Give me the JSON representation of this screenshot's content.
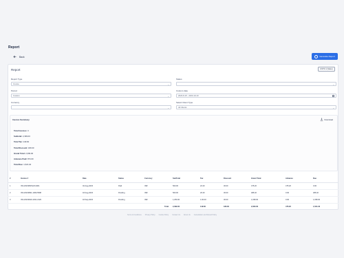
{
  "page": {
    "title": "Report"
  },
  "header": {
    "back_label": "Back",
    "generate_label": "Generate Report"
  },
  "card": {
    "title": "Report",
    "gstr_button": "GSTR-1 (Sales)",
    "fields": {
      "report_type": {
        "label": "Report Type",
        "value": "Invoice"
      },
      "status": {
        "label": "Status",
        "value": ""
      },
      "period": {
        "label": "Period",
        "value": "Custom"
      },
      "custom_date": {
        "label": "Custom date",
        "value": "2023-8-15 - 2023-10-10"
      },
      "currency": {
        "label": "Currency",
        "value": ""
      },
      "client_type": {
        "label": "Select Client Type",
        "value": "All Clients"
      }
    }
  },
  "summary": {
    "title": "Invoice Summary",
    "download_label": "Download",
    "lines": [
      {
        "key": "Total Invoices:",
        "value": "3"
      },
      {
        "key": "Subtotal:",
        "value": "2,399.00"
      },
      {
        "key": "Total Tax:",
        "value": "149.60"
      },
      {
        "key": "Total Discount:",
        "value": "180.00"
      },
      {
        "key": "Grand Total:",
        "value": "2,399.00"
      },
      {
        "key": "Advance Paid:",
        "value": "874.60"
      },
      {
        "key": "Total Due:",
        "value": "1,524.40"
      }
    ]
  },
  "table": {
    "headers": [
      "#",
      "Invoice #",
      "Date",
      "Status",
      "Currency",
      "SubTotal",
      "Tax",
      "Discount",
      "Grand Total",
      "Advance",
      "Due"
    ],
    "rows": [
      [
        "1",
        "INV-20230815123-9401",
        "02-Aug-2023",
        "Paid",
        "INR",
        "500.00",
        "22.20",
        "30.00",
        "475.20",
        "475.20",
        "0.00"
      ],
      [
        "2",
        "INV-20230821-1009-5598",
        "18-Aug-2023",
        "Pending",
        "INR",
        "500.00",
        "26.40",
        "30.00",
        "486.40",
        "0.00",
        "486.40"
      ],
      [
        "3",
        "INV-20230919-1031-2129",
        "18-Sep-2023",
        "Pending",
        "INR",
        "1,250.00",
        "1.00.00",
        "30.00",
        "1,038.00",
        "0.00",
        "1,038.00"
      ]
    ],
    "total": {
      "label": "Total",
      "subtotal": "2,399.00",
      "tax": "149.60",
      "discount": "180.00",
      "grand_total": "2,000.00",
      "advance": "475.20",
      "due": "1,524.40"
    }
  },
  "footer": {
    "links": [
      "Terms & Conditions",
      "Privacy Policy",
      "Cookie Policy",
      "Contact Us",
      "About Us",
      "Cancellation and Refund Policy"
    ]
  }
}
